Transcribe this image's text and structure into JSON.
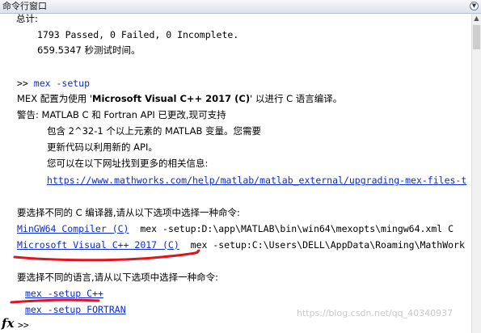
{
  "window": {
    "title": "命令行窗口",
    "menu_icon": "chevron-down-icon"
  },
  "console": {
    "summary_label": "总计:",
    "summary_counts": "1793 Passed, 0 Failed, 0 Incomplete.",
    "summary_time": "659.5347 秒测试时间。",
    "cmd1_prompt": ">> ",
    "cmd1_text": "mex -setup",
    "mex_config_prefix": "MEX 配置为使用 '",
    "mex_config_compiler": "Microsoft Visual C++ 2017 (C)",
    "mex_config_suffix": "' 以进行 C 语言编译。",
    "warn_line1": "警告: MATLAB C 和 Fortran API 已更改,现可支持",
    "warn_line2": "包含 2^32-1 个以上元素的 MATLAB 变量。您需要",
    "warn_line3": "更新代码以利用新的 API。",
    "warn_line4": "您可以在以下网址找到更多的相关信息:",
    "warn_url": "https://www.mathworks.com/help/matlab/matlab_external/upgrading-mex-files-t",
    "choose_compiler_label": "要选择不同的 C 编译器,请从以下选项中选择一种命令:",
    "compiler_option1_link": "MinGW64 Compiler (C)",
    "compiler_option1_cmd": "  mex -setup:D:\\app\\MATLAB\\bin\\win64\\mexopts\\mingw64.xml C",
    "compiler_option2_link": "Microsoft Visual C++ 2017 (C)",
    "compiler_option2_cmd": "  mex -setup:C:\\Users\\DELL\\AppData\\Roaming\\MathWork",
    "choose_language_label": "要选择不同的语言,请从以下选项中选择一种命令:",
    "language_option1": "mex -setup C++",
    "language_option2": "mex -setup FORTRAN",
    "fx_label": "fx",
    "cmd_prompt": ">>"
  },
  "watermark": "https://blog.csdn.net/qq_40340937",
  "colors": {
    "link": "#0b2bd6",
    "annotation": "#e0141e"
  }
}
